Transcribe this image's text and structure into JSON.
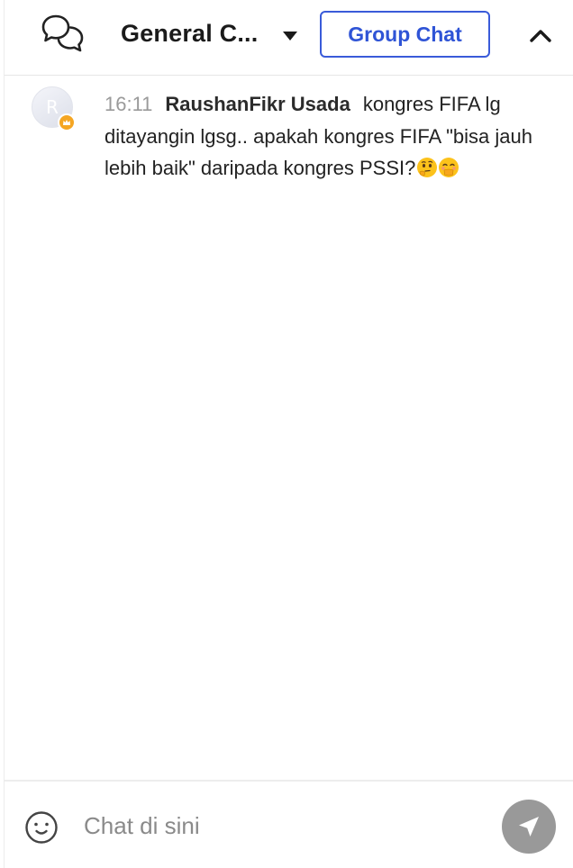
{
  "header": {
    "room_title": "General C...",
    "group_chat_label": "Group Chat"
  },
  "messages": [
    {
      "avatar_initial": "R",
      "time": "16:11",
      "author": "RaushanFikr Usada",
      "text": "kongres FIFA lg ditayangin lgsg.. apakah kongres FIFA \"bisa jauh lebih baik\" daripada kongres PSSI?",
      "emojis": [
        "thinking-face",
        "face-with-hand-over-mouth"
      ]
    }
  ],
  "composer": {
    "placeholder": "Chat di sini"
  },
  "colors": {
    "accent": "#2f54d6",
    "send_button": "#999999",
    "badge": "#f5a623",
    "timestamp": "#9a9a9a"
  }
}
